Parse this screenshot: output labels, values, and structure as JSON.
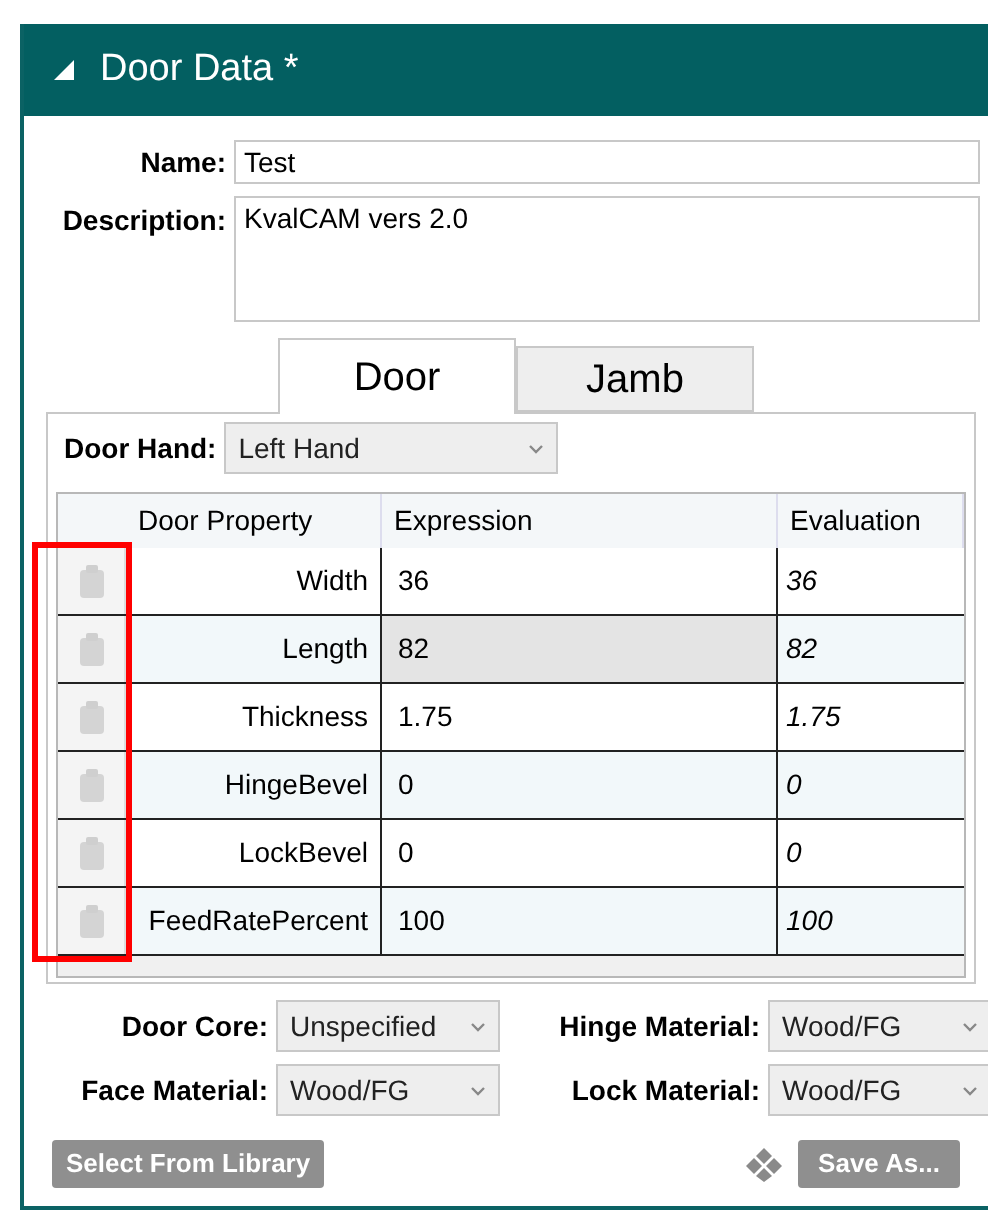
{
  "panel": {
    "title": "Door Data *",
    "expanded": true
  },
  "name": {
    "label": "Name:",
    "value": "Test"
  },
  "description": {
    "label": "Description:",
    "value": "KvalCAM vers 2.0"
  },
  "tabs": [
    {
      "label": "Door",
      "selected": true
    },
    {
      "label": "Jamb",
      "selected": false
    }
  ],
  "door_hand": {
    "label": "Door Hand:",
    "value": "Left Hand"
  },
  "table": {
    "columns": [
      "Door Property",
      "Expression",
      "Evaluation"
    ],
    "rows": [
      {
        "property": "Width",
        "expression": "36",
        "evaluation": "36",
        "selected": false
      },
      {
        "property": "Length",
        "expression": "82",
        "evaluation": "82",
        "selected": true
      },
      {
        "property": "Thickness",
        "expression": "1.75",
        "evaluation": "1.75",
        "selected": false
      },
      {
        "property": "HingeBevel",
        "expression": "0",
        "evaluation": "0",
        "selected": false
      },
      {
        "property": "LockBevel",
        "expression": "0",
        "evaluation": "0",
        "selected": false
      },
      {
        "property": "FeedRatePercent",
        "expression": "100",
        "evaluation": "100",
        "selected": false
      }
    ]
  },
  "materials": [
    {
      "label": "Door Core:",
      "value": "Unspecified"
    },
    {
      "label": "Hinge Material:",
      "value": "Wood/FG"
    },
    {
      "label": "Face Material:",
      "value": "Wood/FG"
    },
    {
      "label": "Lock Material:",
      "value": "Wood/FG"
    }
  ],
  "buttons": {
    "library": "Select From Library",
    "save": "Save As..."
  }
}
